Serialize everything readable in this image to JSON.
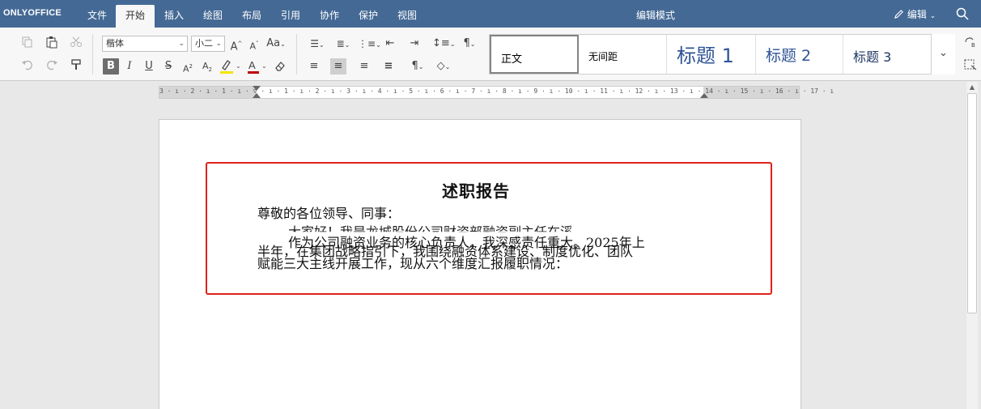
{
  "app": {
    "brand": "ONLYOFFICE",
    "mode_title": "编辑模式",
    "edit_label": "编辑"
  },
  "menu": {
    "tabs": [
      "文件",
      "开始",
      "插入",
      "绘图",
      "布局",
      "引用",
      "协作",
      "保护",
      "视图"
    ],
    "active": "开始"
  },
  "toolbar": {
    "font_name": "楷体",
    "font_size": "小二",
    "styles": {
      "normal": "正文",
      "no_spacing": "无间距",
      "heading1": "标题 1",
      "heading2": "标题 2",
      "heading3": "标题 3"
    },
    "colors": {
      "highlight_color": "#f5e400",
      "font_color": "#c00000"
    }
  },
  "ruler": {
    "marks": "3 · ı · 2 · ı · 1 · ı · ▽ · ı · 1 · ı · 2 · ı · 3 · ı · 4 · ı · 5 · ı · 6 · ı · 7 · ı · 8 · ı · 9 · ı · 10 · ı · 11 · ı · 12 · ı · 13 · ı · 14 · ı · 15 · ı · 16 · ı · 17 · ı"
  },
  "document": {
    "title": "述职报告",
    "lines": [
      "尊敬的各位领导、同事：",
      "大家好！我是龙城股份公司财资部融资副主任在溪",
      "作为公司融资业务的核心负责人，我深感责任重大。2025年上",
      "半年，在集团战略指引下，我围绕融资体系建设、制度优化、团队",
      "赋能三大主线开展工作，现从六个维度汇报履职情况："
    ]
  }
}
